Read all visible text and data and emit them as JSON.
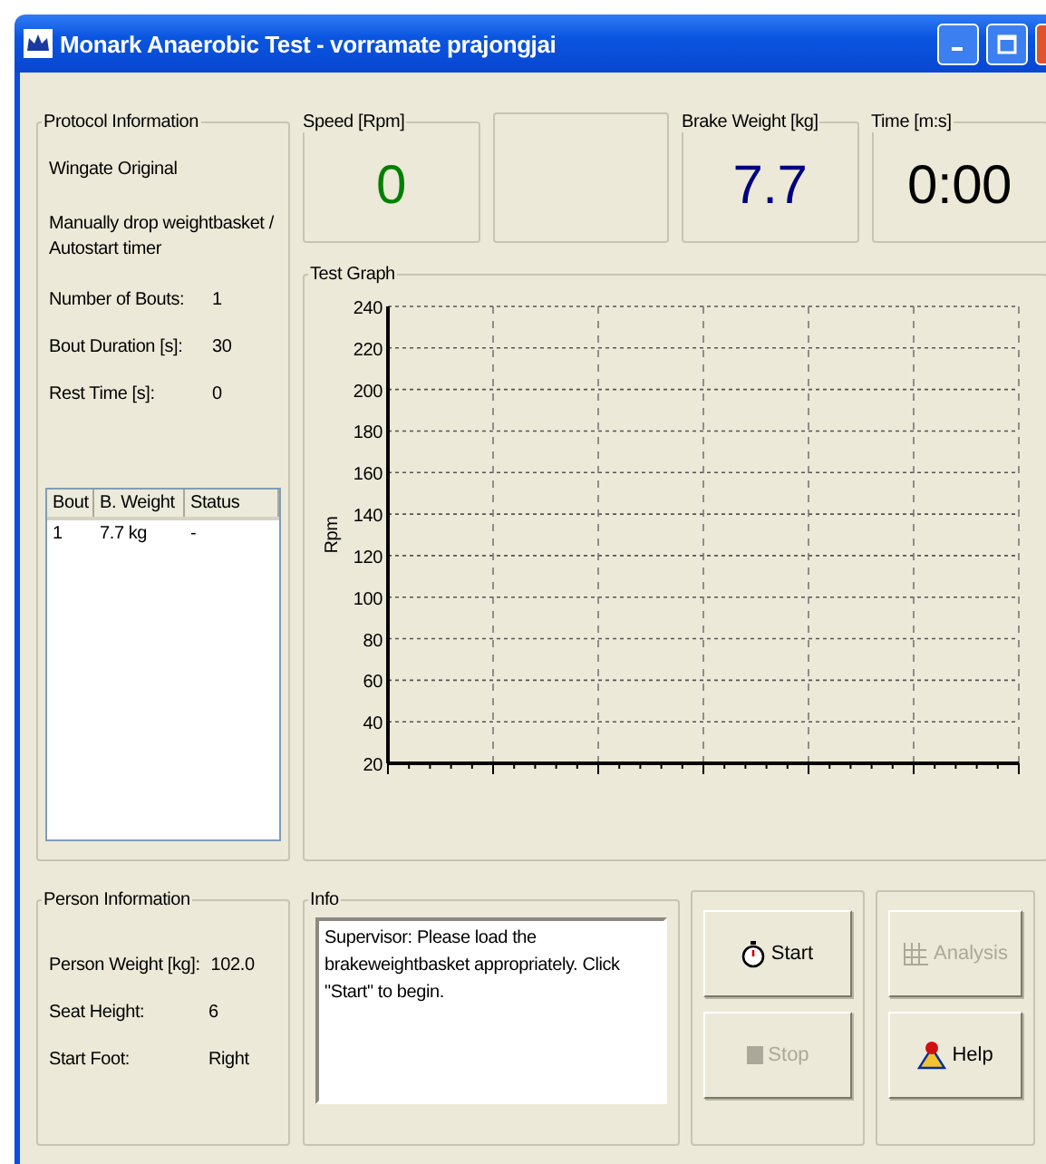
{
  "window": {
    "title": "Monark Anaerobic Test - vorramate prajongjai"
  },
  "protocol": {
    "title": "Protocol Information",
    "name": "Wingate Original",
    "mode": "Manually drop weightbasket / Autostart timer",
    "fields": [
      {
        "label": "Number of Bouts:",
        "value": "1"
      },
      {
        "label": "Bout Duration [s]:",
        "value": "30"
      },
      {
        "label": "Rest Time [s]:",
        "value": "0"
      }
    ]
  },
  "bouts_table": {
    "columns": [
      "Bout",
      "B. Weight",
      "Status"
    ],
    "rows": [
      [
        "1",
        "7.7 kg",
        "-"
      ]
    ]
  },
  "person": {
    "title": "Person Information",
    "fields": [
      {
        "label": "Person Weight [kg]:",
        "value": "102.0"
      },
      {
        "label": "Seat Height:",
        "value": "6"
      },
      {
        "label": "Start Foot:",
        "value": "Right"
      }
    ]
  },
  "readouts": [
    {
      "kind": "value",
      "title": "Speed [Rpm]",
      "value": "0",
      "color": "#008000"
    },
    {
      "kind": "blank"
    },
    {
      "kind": "value",
      "title": "Brake Weight [kg]",
      "value": "7.7",
      "color": "#000080"
    },
    {
      "kind": "value",
      "title": "Time [m:s]",
      "value": "0:00",
      "color": "#000000"
    }
  ],
  "graph": {
    "title": "Test Graph",
    "y_axis_title": "Rpm",
    "y_axis_labels": [
      "240",
      "220",
      "200",
      "180",
      "160",
      "140",
      "120",
      "100",
      "80",
      "60",
      "40",
      "20"
    ]
  },
  "info": {
    "title": "Info",
    "text": "Supervisor: Please load the brakeweightbasket appropriately. Click \"Start\" to begin."
  },
  "buttons": [
    {
      "label": "Start",
      "kind": "timer",
      "disabled": false
    },
    {
      "label": "Stop",
      "kind": "stop",
      "disabled": true
    },
    {
      "label": "Analysis",
      "kind": "analysis",
      "disabled": true
    },
    {
      "label": "Help",
      "kind": "help",
      "disabled": false
    }
  ]
}
